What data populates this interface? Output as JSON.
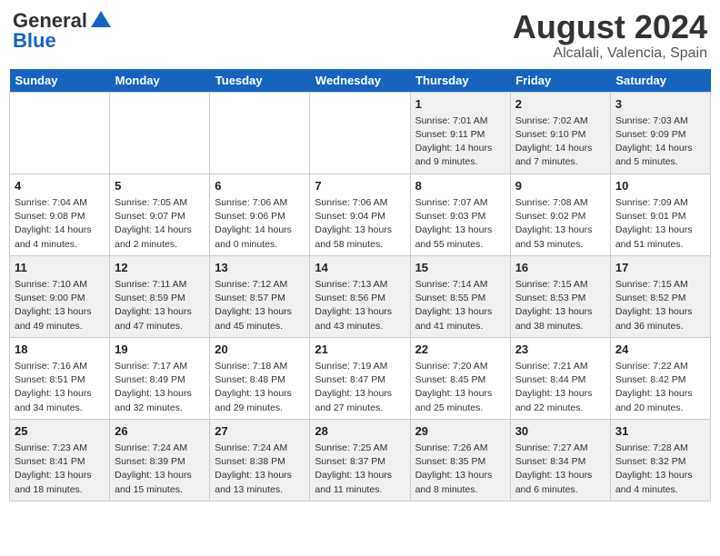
{
  "header": {
    "logo_general": "General",
    "logo_blue": "Blue",
    "month_year": "August 2024",
    "location": "Alcalali, Valencia, Spain"
  },
  "weekdays": [
    "Sunday",
    "Monday",
    "Tuesday",
    "Wednesday",
    "Thursday",
    "Friday",
    "Saturday"
  ],
  "weeks": [
    [
      {
        "day": "",
        "info": ""
      },
      {
        "day": "",
        "info": ""
      },
      {
        "day": "",
        "info": ""
      },
      {
        "day": "",
        "info": ""
      },
      {
        "day": "1",
        "info": "Sunrise: 7:01 AM\nSunset: 9:11 PM\nDaylight: 14 hours\nand 9 minutes."
      },
      {
        "day": "2",
        "info": "Sunrise: 7:02 AM\nSunset: 9:10 PM\nDaylight: 14 hours\nand 7 minutes."
      },
      {
        "day": "3",
        "info": "Sunrise: 7:03 AM\nSunset: 9:09 PM\nDaylight: 14 hours\nand 5 minutes."
      }
    ],
    [
      {
        "day": "4",
        "info": "Sunrise: 7:04 AM\nSunset: 9:08 PM\nDaylight: 14 hours\nand 4 minutes."
      },
      {
        "day": "5",
        "info": "Sunrise: 7:05 AM\nSunset: 9:07 PM\nDaylight: 14 hours\nand 2 minutes."
      },
      {
        "day": "6",
        "info": "Sunrise: 7:06 AM\nSunset: 9:06 PM\nDaylight: 14 hours\nand 0 minutes."
      },
      {
        "day": "7",
        "info": "Sunrise: 7:06 AM\nSunset: 9:04 PM\nDaylight: 13 hours\nand 58 minutes."
      },
      {
        "day": "8",
        "info": "Sunrise: 7:07 AM\nSunset: 9:03 PM\nDaylight: 13 hours\nand 55 minutes."
      },
      {
        "day": "9",
        "info": "Sunrise: 7:08 AM\nSunset: 9:02 PM\nDaylight: 13 hours\nand 53 minutes."
      },
      {
        "day": "10",
        "info": "Sunrise: 7:09 AM\nSunset: 9:01 PM\nDaylight: 13 hours\nand 51 minutes."
      }
    ],
    [
      {
        "day": "11",
        "info": "Sunrise: 7:10 AM\nSunset: 9:00 PM\nDaylight: 13 hours\nand 49 minutes."
      },
      {
        "day": "12",
        "info": "Sunrise: 7:11 AM\nSunset: 8:59 PM\nDaylight: 13 hours\nand 47 minutes."
      },
      {
        "day": "13",
        "info": "Sunrise: 7:12 AM\nSunset: 8:57 PM\nDaylight: 13 hours\nand 45 minutes."
      },
      {
        "day": "14",
        "info": "Sunrise: 7:13 AM\nSunset: 8:56 PM\nDaylight: 13 hours\nand 43 minutes."
      },
      {
        "day": "15",
        "info": "Sunrise: 7:14 AM\nSunset: 8:55 PM\nDaylight: 13 hours\nand 41 minutes."
      },
      {
        "day": "16",
        "info": "Sunrise: 7:15 AM\nSunset: 8:53 PM\nDaylight: 13 hours\nand 38 minutes."
      },
      {
        "day": "17",
        "info": "Sunrise: 7:15 AM\nSunset: 8:52 PM\nDaylight: 13 hours\nand 36 minutes."
      }
    ],
    [
      {
        "day": "18",
        "info": "Sunrise: 7:16 AM\nSunset: 8:51 PM\nDaylight: 13 hours\nand 34 minutes."
      },
      {
        "day": "19",
        "info": "Sunrise: 7:17 AM\nSunset: 8:49 PM\nDaylight: 13 hours\nand 32 minutes."
      },
      {
        "day": "20",
        "info": "Sunrise: 7:18 AM\nSunset: 8:48 PM\nDaylight: 13 hours\nand 29 minutes."
      },
      {
        "day": "21",
        "info": "Sunrise: 7:19 AM\nSunset: 8:47 PM\nDaylight: 13 hours\nand 27 minutes."
      },
      {
        "day": "22",
        "info": "Sunrise: 7:20 AM\nSunset: 8:45 PM\nDaylight: 13 hours\nand 25 minutes."
      },
      {
        "day": "23",
        "info": "Sunrise: 7:21 AM\nSunset: 8:44 PM\nDaylight: 13 hours\nand 22 minutes."
      },
      {
        "day": "24",
        "info": "Sunrise: 7:22 AM\nSunset: 8:42 PM\nDaylight: 13 hours\nand 20 minutes."
      }
    ],
    [
      {
        "day": "25",
        "info": "Sunrise: 7:23 AM\nSunset: 8:41 PM\nDaylight: 13 hours\nand 18 minutes."
      },
      {
        "day": "26",
        "info": "Sunrise: 7:24 AM\nSunset: 8:39 PM\nDaylight: 13 hours\nand 15 minutes."
      },
      {
        "day": "27",
        "info": "Sunrise: 7:24 AM\nSunset: 8:38 PM\nDaylight: 13 hours\nand 13 minutes."
      },
      {
        "day": "28",
        "info": "Sunrise: 7:25 AM\nSunset: 8:37 PM\nDaylight: 13 hours\nand 11 minutes."
      },
      {
        "day": "29",
        "info": "Sunrise: 7:26 AM\nSunset: 8:35 PM\nDaylight: 13 hours\nand 8 minutes."
      },
      {
        "day": "30",
        "info": "Sunrise: 7:27 AM\nSunset: 8:34 PM\nDaylight: 13 hours\nand 6 minutes."
      },
      {
        "day": "31",
        "info": "Sunrise: 7:28 AM\nSunset: 8:32 PM\nDaylight: 13 hours\nand 4 minutes."
      }
    ]
  ]
}
